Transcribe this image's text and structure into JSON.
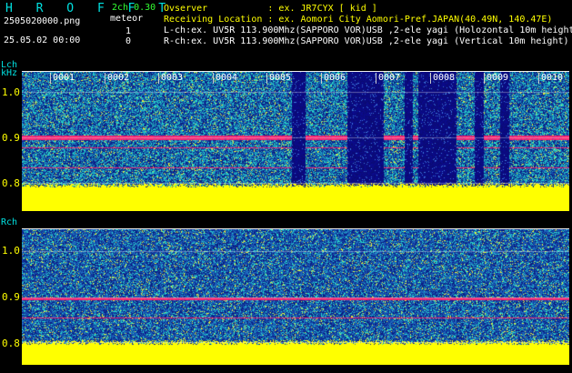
{
  "brand": "H R O F F T",
  "mode": "2ch 0.30",
  "kind": "meteor",
  "file": "2505020000.png",
  "date": "25.05.02 00:00",
  "count_l": "1",
  "count_r": "0",
  "header": {
    "observer": "Ovserver           : ex. JR7CYX [ kid ]",
    "location": "Receiving Location : ex. Aomori City Aomori-Pref.JAPAN(40.49N, 140.47E)",
    "lch": "L-ch:ex. UV5R 113.900Mhz(SAPPORO VOR)USB ,2-ele yagi (Holozontal 10m height",
    "rch": "R-ch:ex. UV5R 113.900Mhz(SAPPORO VOR)USB ,2-ele yagi (Vertical 10m height)"
  },
  "lch_label": "Lch",
  "khz_label": "kHz",
  "rch_label": "Rch",
  "y_ticks": [
    "1.0",
    "0.9",
    "0.8"
  ],
  "minute_ticks": [
    "0001",
    "0002",
    "0003",
    "0004",
    "0005",
    "0006",
    "0007",
    "0008",
    "0009",
    "0010"
  ],
  "colors": {
    "noise_bg": "#1a3a9a",
    "noise_hi": "#00e0c0",
    "signal": "#ff3060",
    "floor": "#ffff00",
    "dark_band": "#0a0a6a"
  }
}
